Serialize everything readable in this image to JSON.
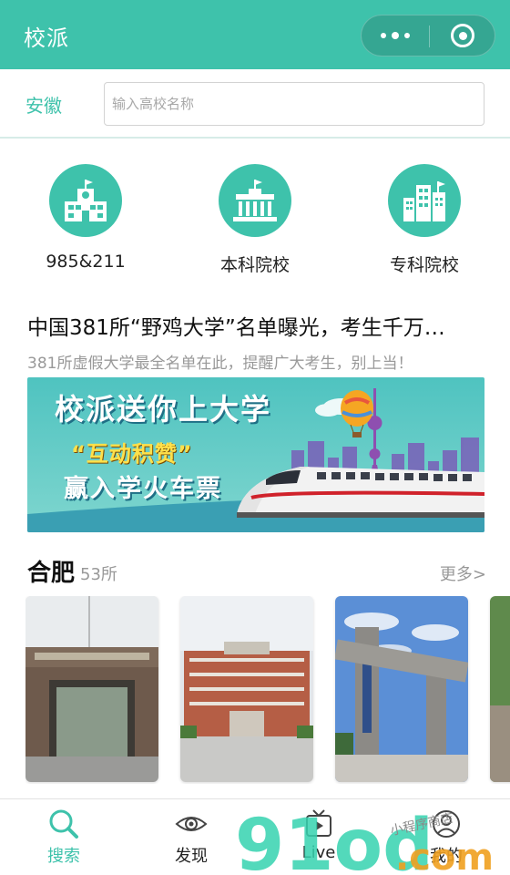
{
  "header": {
    "title": "校派"
  },
  "search": {
    "province": "安徽",
    "placeholder": "输入高校名称",
    "value": ""
  },
  "categories": [
    {
      "label": "985&211",
      "icon": "school-building-icon"
    },
    {
      "label": "本科院校",
      "icon": "government-building-icon"
    },
    {
      "label": "专科院校",
      "icon": "city-buildings-icon"
    }
  ],
  "article": {
    "title": "中国381所“野鸡大学”名单曝光，考生千万…",
    "subtitle": "381所虚假大学最全名单在此，提醒广大考生，别上当！"
  },
  "banner": {
    "line1": "校派送你上大学",
    "line2": "“互动积赞”",
    "line3": "赢入学火车票"
  },
  "section": {
    "title": "合肥",
    "count": "53所",
    "more": "更多>"
  },
  "tabs": [
    {
      "label": "搜索",
      "icon": "search-icon",
      "active": true
    },
    {
      "label": "发现",
      "icon": "eye-icon",
      "active": false
    },
    {
      "label": "Live",
      "icon": "live-tv-icon",
      "active": false
    },
    {
      "label": "我的",
      "icon": "user-icon",
      "active": false
    }
  ],
  "watermark": {
    "logo": "91od.com",
    "text": "小程序商店"
  },
  "colors": {
    "accent": "#3ec2ab",
    "text": "#111111",
    "muted": "#999999"
  }
}
